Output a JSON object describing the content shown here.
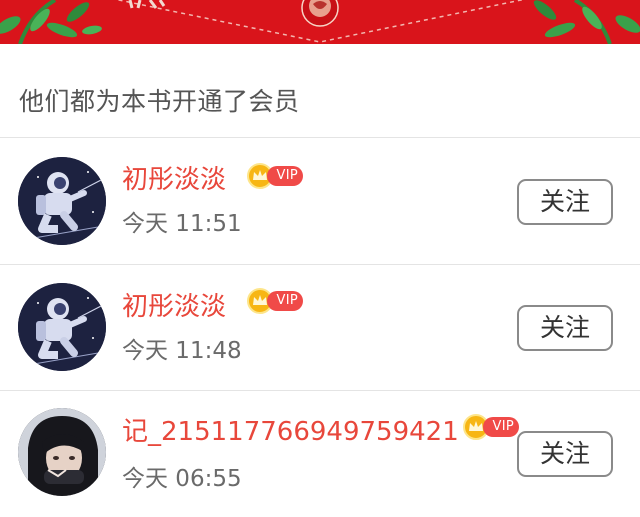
{
  "section": {
    "title": "他们都为本书开通了会员"
  },
  "members": [
    {
      "name": "初彤淡淡",
      "badge": "VIP",
      "time": "今天 11:51",
      "follow_label": "关注",
      "avatar": "astronaut-avatar"
    },
    {
      "name": "初彤淡淡",
      "badge": "VIP",
      "time": "今天 11:48",
      "follow_label": "关注",
      "avatar": "astronaut-avatar"
    },
    {
      "name": "记_215117766949759421",
      "badge": "VIP",
      "time": "今天 06:55",
      "follow_label": "关注",
      "avatar": "portrait-avatar"
    }
  ],
  "colors": {
    "banner": "#d9141b",
    "name": "#e8473b",
    "vip": "#f04a48",
    "crown": "#f7b614"
  }
}
